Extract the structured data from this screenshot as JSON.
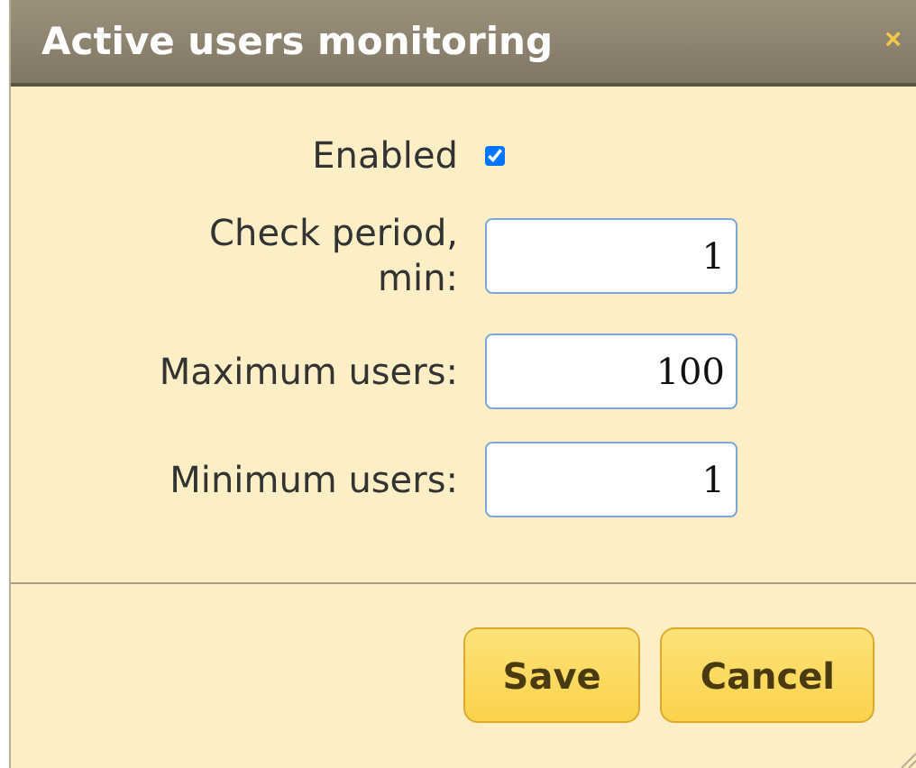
{
  "window": {
    "title": "Active users monitoring",
    "close": "×"
  },
  "fields": [
    {
      "kind": "checkbox",
      "label": "Enabled",
      "checked": true
    },
    {
      "kind": "text",
      "label": "Check period, min:",
      "value": "1"
    },
    {
      "kind": "text",
      "label": "Maximum users:",
      "value": "100"
    },
    {
      "kind": "text",
      "label": "Minimum users:",
      "value": "1"
    }
  ],
  "buttons": [
    "Save",
    "Cancel"
  ]
}
